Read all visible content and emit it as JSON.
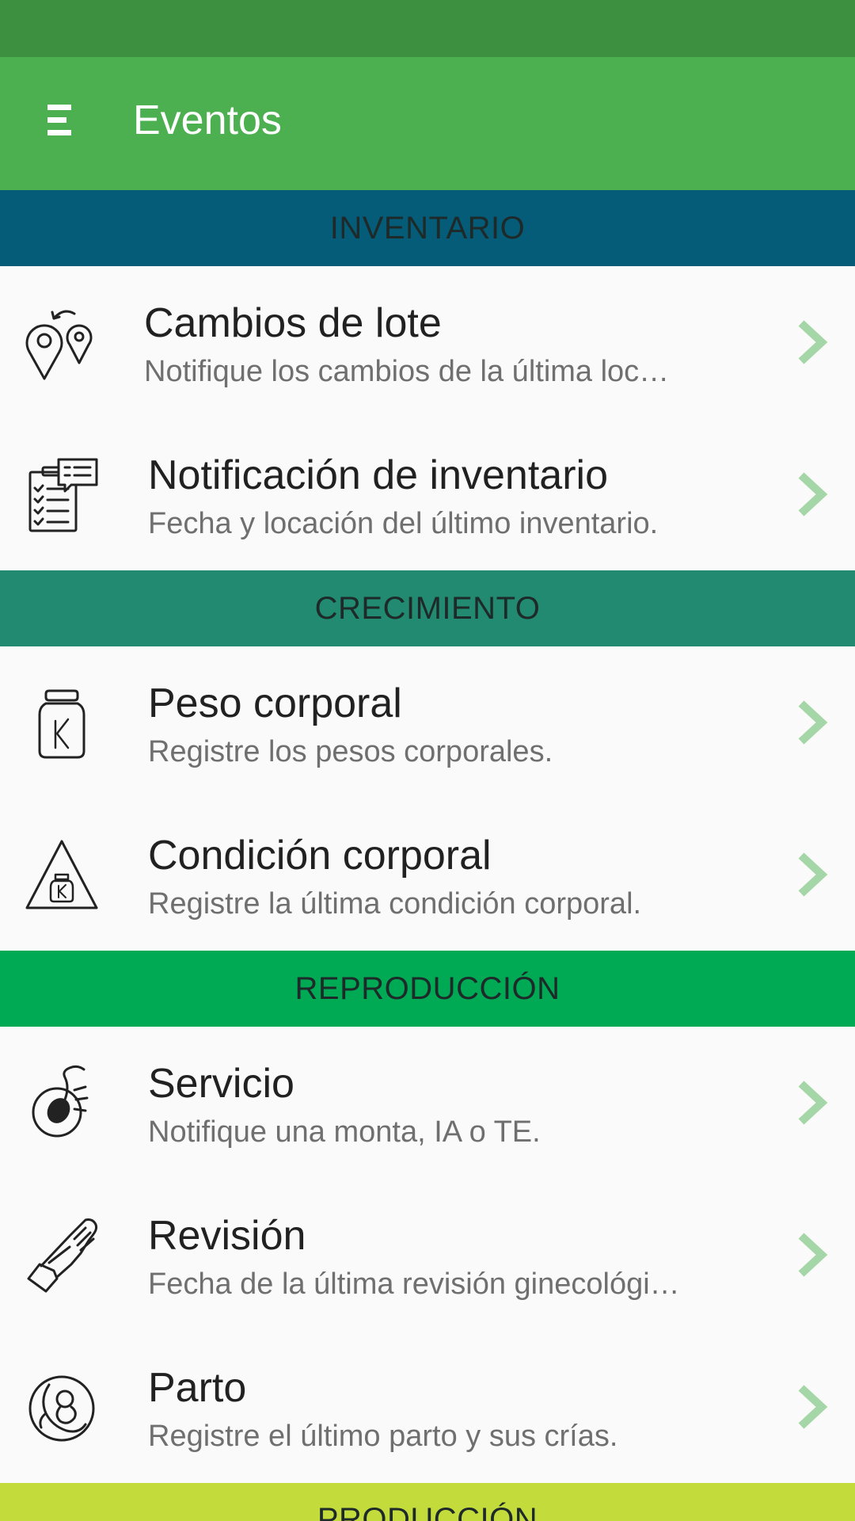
{
  "app": {
    "title": "Eventos",
    "menu_icon": "menu-icon",
    "colors": {
      "status_bar": "#3c9040",
      "app_bar": "#4caf50",
      "chevron": "#a5d6a7"
    }
  },
  "sections": [
    {
      "label": "INVENTARIO",
      "color": "#045c78",
      "items": [
        {
          "title": "Cambios de lote",
          "subtitle": "Notifique los cambios de la última loc…",
          "icon": "location-change-icon"
        },
        {
          "title": "Notificación de inventario",
          "subtitle": "Fecha y locación del último inventario.",
          "icon": "inventory-clipboard-icon"
        }
      ]
    },
    {
      "label": "CRECIMIENTO",
      "color": "#218a70",
      "items": [
        {
          "title": "Peso corporal",
          "subtitle": "Registre los pesos corporales.",
          "icon": "weight-icon"
        },
        {
          "title": "Condición corporal",
          "subtitle": "Registre la última condición corporal.",
          "icon": "body-condition-icon"
        }
      ]
    },
    {
      "label": "REPRODUCCIÓN",
      "color": "#00a954",
      "items": [
        {
          "title": "Servicio",
          "subtitle": "Notifique una monta, IA o TE.",
          "icon": "insemination-icon"
        },
        {
          "title": "Revisión",
          "subtitle": "Fecha de la última revisión ginecológi…",
          "icon": "glove-icon"
        },
        {
          "title": "Parto",
          "subtitle": "Registre el último parto y sus crías.",
          "icon": "birth-icon"
        }
      ]
    },
    {
      "label": "PRODUCCIÓN",
      "color": "#c3dc3c",
      "items": []
    }
  ]
}
